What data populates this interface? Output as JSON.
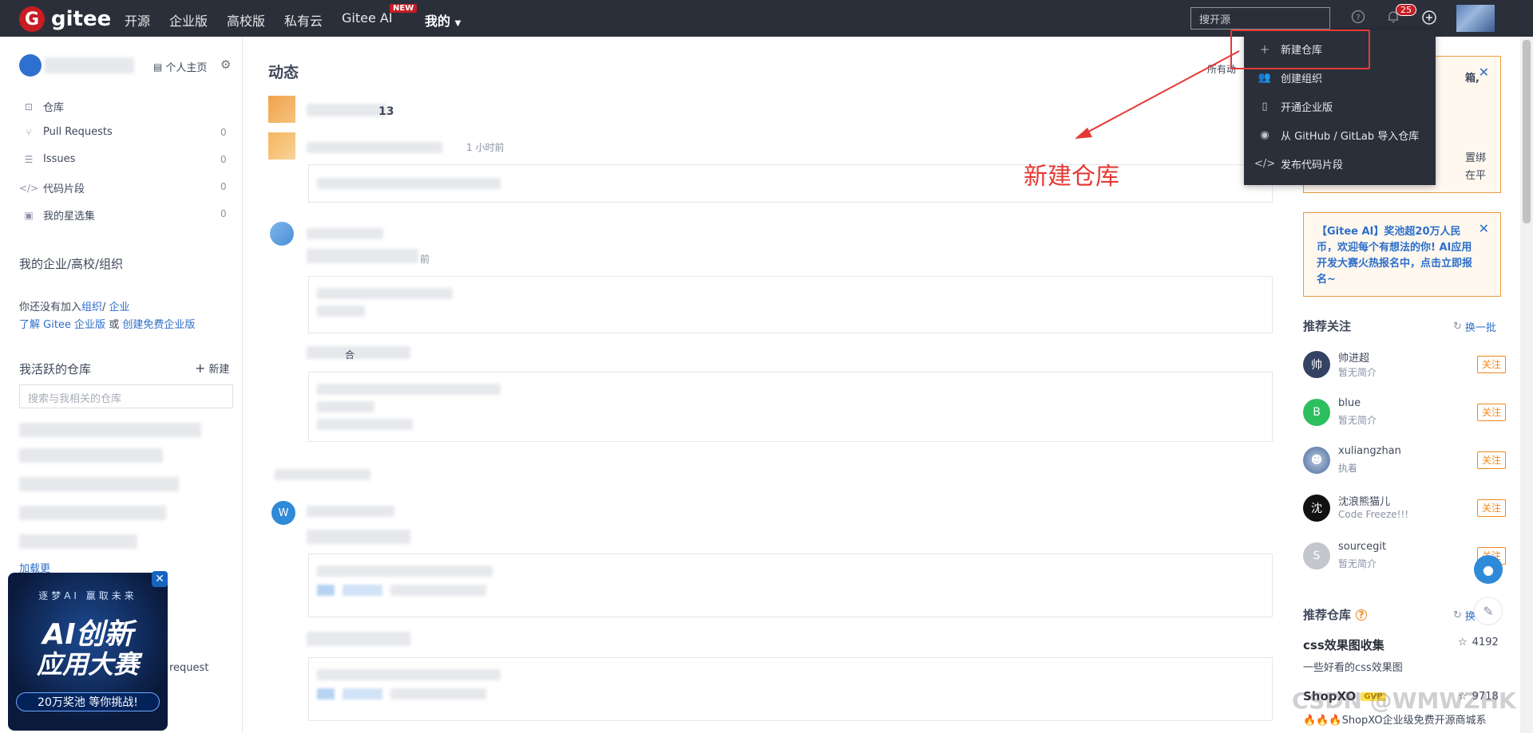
{
  "topbar": {
    "logo": "gitee",
    "nav": [
      "开源",
      "企业版",
      "高校版",
      "私有云",
      "Gitee AI",
      "我的"
    ],
    "nav_badge": "NEW",
    "search_placeholder": "搜开源",
    "notification_count": "25"
  },
  "dropdown": {
    "items": [
      "新建仓库",
      "创建组织",
      "开通企业版",
      "从 GitHub / GitLab 导入仓库",
      "发布代码片段"
    ]
  },
  "annotation": "新建仓库",
  "sidebar": {
    "homepage_link": "个人主页",
    "items": [
      {
        "label": "仓库",
        "count": ""
      },
      {
        "label": "Pull Requests",
        "count": "0"
      },
      {
        "label": "Issues",
        "count": "0"
      },
      {
        "label": "代码片段",
        "count": "0"
      },
      {
        "label": "我的星选集",
        "count": "0"
      }
    ],
    "org_title": "我的企业/高校/组织",
    "org_text_1": "你还没有加入",
    "org_link_1": "组织",
    "org_link_2": "企业",
    "org_text_2_prefix": "了解 Gitee 企业版",
    "org_text_2_mid": "或",
    "org_link_3": "创建免费企业版",
    "active_repos_title": "我活跃的仓库",
    "new_button": "新建",
    "repo_search_placeholder": "搜索与我相关的仓库",
    "load_more": "加载更",
    "request_text": "request"
  },
  "ad": {
    "line1": "逐梦AI 赢取未来",
    "line2": "AI创新",
    "line3": "应用大赛",
    "line4": "20万奖池 等你挑战!"
  },
  "main": {
    "title": "动态",
    "filter_label": "所有动",
    "time_1": "1 小时前",
    "time_2": "前",
    "fragment_1": "13",
    "fragment_2": "合",
    "avatar_letter": "W"
  },
  "right": {
    "notice1_fragments": [
      "箱,",
      "置绑",
      "在平"
    ],
    "notice2": "【Gitee AI】奖池超20万人民币，欢迎每个有想法的你! AI应用开发大赛火热报名中，点击立即报名~",
    "follow_title": "推荐关注",
    "refresh": "换一批",
    "follow_button": "关注",
    "follows": [
      {
        "avatar": "帅",
        "name": "帅进超",
        "desc": "暂无简介",
        "color": "#344263"
      },
      {
        "avatar": "B",
        "name": "blue",
        "desc": "暂无简介",
        "color": "#2dbe60"
      },
      {
        "avatar": "",
        "name": "xuliangzhan",
        "desc": "执着",
        "color": "#7a5a3a"
      },
      {
        "avatar": "沈",
        "name": "沈浪熊猫儿",
        "desc": "Code Freeze!!!",
        "color": "#111111"
      },
      {
        "avatar": "S",
        "name": "sourcegit",
        "desc": "暂无简介",
        "color": "#c3c6cc"
      }
    ],
    "repos_title": "推荐仓库",
    "repos_refresh": "换",
    "repos": [
      {
        "name": "css效果图收集",
        "stars": "4192",
        "desc": "一些好看的css效果图"
      },
      {
        "name": "ShopXO",
        "badge": "GVP",
        "stars": "9718",
        "desc": "ShopXO企业级免费开源商城系"
      }
    ]
  },
  "watermark": "CSDN @WMWZHK"
}
